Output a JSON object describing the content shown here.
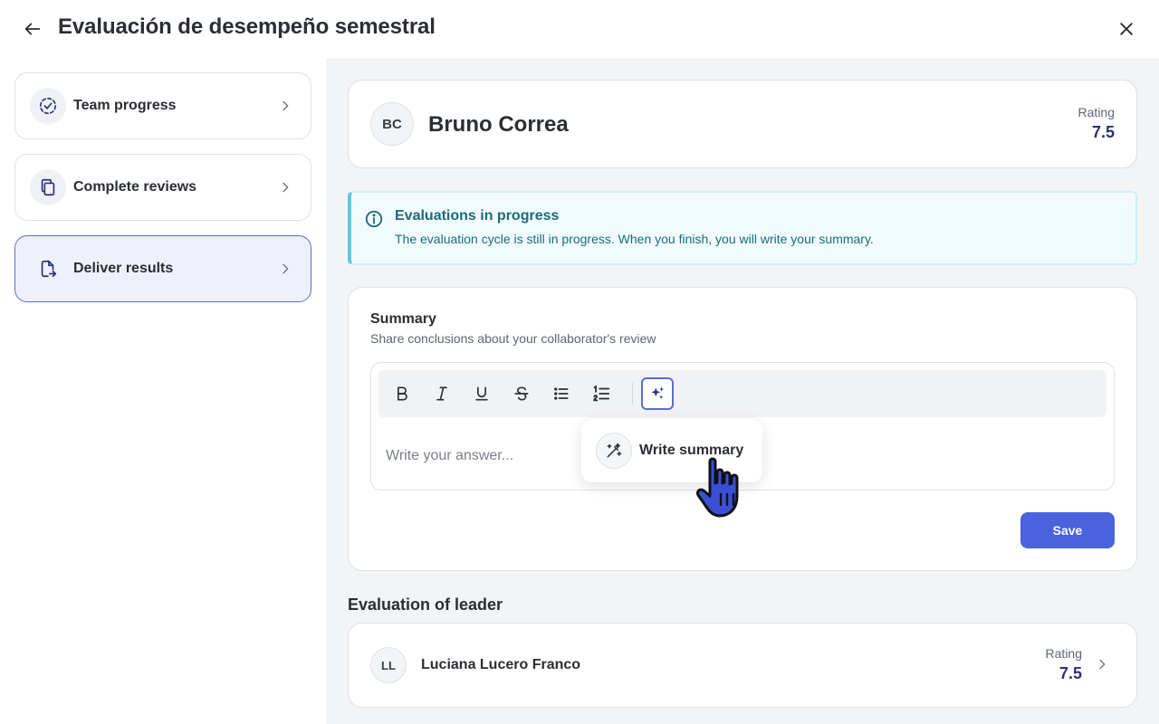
{
  "header": {
    "title": "Evaluación de desempeño semestral",
    "back_icon": "arrow-left-icon",
    "close_icon": "close-icon"
  },
  "sidebar": {
    "items": [
      {
        "label": "Team progress",
        "icon": "progress-check-icon",
        "active": false
      },
      {
        "label": "Complete reviews",
        "icon": "copy-documents-icon",
        "active": false
      },
      {
        "label": "Deliver results",
        "icon": "file-export-icon",
        "active": true
      }
    ]
  },
  "profile": {
    "initials": "BC",
    "name": "Bruno Correa",
    "rating_label": "Rating",
    "rating_value": "7.5"
  },
  "banner": {
    "title": "Evaluations in progress",
    "text": "The evaluation cycle is still in progress. When you finish, you will write your summary."
  },
  "summary": {
    "title": "Summary",
    "subtitle": "Share conclusions about your collaborator's review",
    "placeholder": "Write your answer...",
    "toolbar": [
      "bold-icon",
      "italic-icon",
      "underline-icon",
      "strikethrough-icon",
      "bullet-list-icon",
      "numbered-list-icon",
      "ai-sparkle-icon"
    ],
    "popup_label": "Write summary",
    "save_label": "Save"
  },
  "leader": {
    "heading": "Evaluation of leader",
    "initials": "LL",
    "name": "Luciana Lucero Franco",
    "rating_label": "Rating",
    "rating_value": "7.5"
  },
  "colors": {
    "accent": "#4a63dc",
    "rating": "#2c3277",
    "info": "#1c6a7e"
  }
}
